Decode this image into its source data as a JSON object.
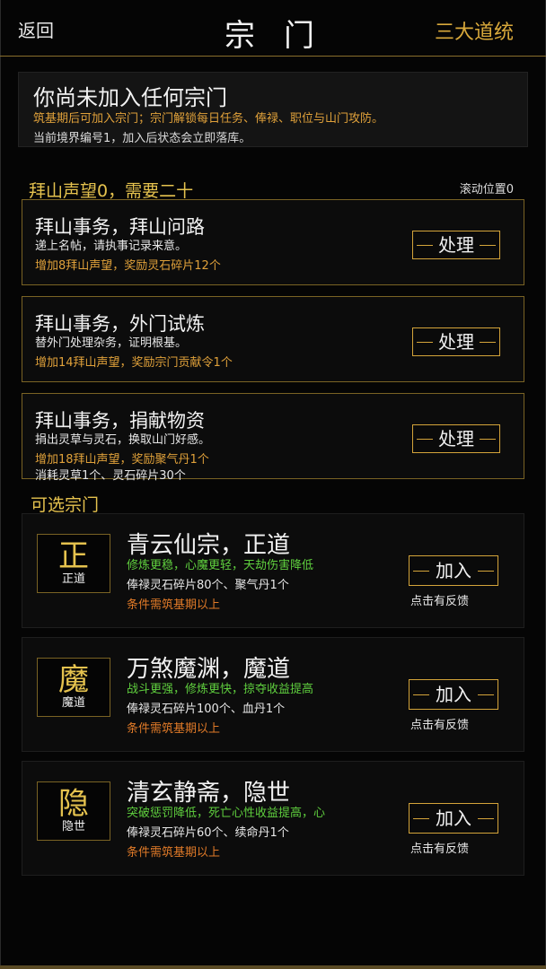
{
  "header": {
    "back_label": "返回",
    "title": "宗门",
    "lineage_label": "三大道统"
  },
  "notice": {
    "title": "你尚未加入任何宗门",
    "desc": "筑基期后可加入宗门；宗门解锁每日任务、俸禄、职位与山门攻防。",
    "sub": "当前境界编号1，加入后状态会立即落库。"
  },
  "reputation": {
    "text": "拜山声望0，需要二十",
    "scroll_text": "滚动位置0"
  },
  "tasks": [
    {
      "title": "拜山事务，拜山问路",
      "desc": "递上名帖，请执事记录来意。",
      "reward": "增加8拜山声望，奖励灵石碎片12个",
      "cost": "",
      "button": "处理"
    },
    {
      "title": "拜山事务，外门试炼",
      "desc": "替外门处理杂务，证明根基。",
      "reward": "增加14拜山声望，奖励宗门贡献令1个",
      "cost": "",
      "button": "处理"
    },
    {
      "title": "拜山事务，捐献物资",
      "desc": "捐出灵草与灵石，换取山门好感。",
      "reward": "增加18拜山声望，奖励聚气丹1个",
      "cost": "消耗灵草1个、灵石碎片30个",
      "button": "处理"
    }
  ],
  "sect_heading": "可选宗门",
  "sects": [
    {
      "emblem_char": "正",
      "emblem_label": "正道",
      "name": "青云仙宗，正道",
      "trait": "修炼更稳，心魔更轻，天劫伤害降低",
      "salary": "俸禄灵石碎片80个、聚气丹1个",
      "requirement": "条件需筑基期以上",
      "button": "加入",
      "feedback": "点击有反馈"
    },
    {
      "emblem_char": "魔",
      "emblem_label": "魔道",
      "name": "万煞魔渊，魔道",
      "trait": "战斗更强，修炼更快，掠夺收益提高",
      "salary": "俸禄灵石碎片100个、血丹1个",
      "requirement": "条件需筑基期以上",
      "button": "加入",
      "feedback": "点击有反馈"
    },
    {
      "emblem_char": "隐",
      "emblem_label": "隐世",
      "name": "清玄静斋，隐世",
      "trait": "突破惩罚降低，死亡心性收益提高，心",
      "salary": "俸禄灵石碎片60个、续命丹1个",
      "requirement": "条件需筑基期以上",
      "button": "加入",
      "feedback": "点击有反馈"
    }
  ],
  "colors": {
    "gold": "#d4a43a",
    "orange": "#e0a13a",
    "green": "#5fcf3e",
    "requirement": "#e07a28",
    "background": "#050505"
  }
}
